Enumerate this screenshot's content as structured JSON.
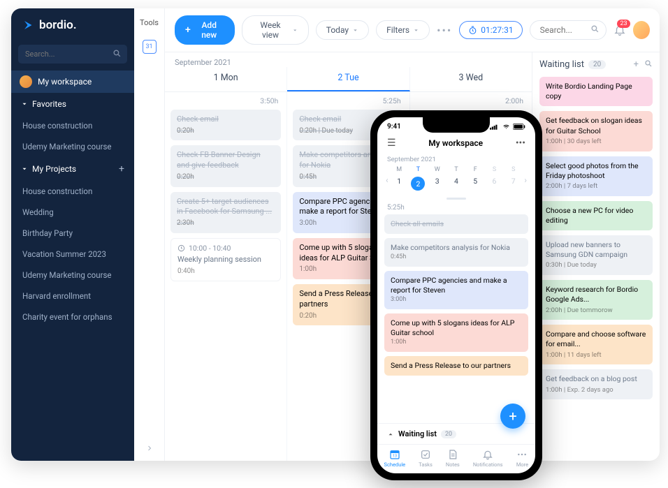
{
  "brand": {
    "name": "bordio."
  },
  "sidebar": {
    "search_placeholder": "Search...",
    "workspace": "My workspace",
    "favorites_label": "Favorites",
    "favorites": [
      "House construction",
      "Udemy Marketing course"
    ],
    "projects_label": "My Projects",
    "projects": [
      "House construction",
      "Wedding",
      "Birthday Party",
      "Vacation Summer 2023",
      "Udemy Marketing course",
      "Harvard enrollment",
      "Charity event for orphans"
    ]
  },
  "tools_label": "Tools",
  "calendar_day": "31",
  "toolbar": {
    "add": "Add new",
    "view": "Week view",
    "today": "Today",
    "filters": "Filters",
    "timer": "01:27:31",
    "search_placeholder": "Search...",
    "badge": "23"
  },
  "schedule": {
    "month": "September 2021",
    "days": [
      {
        "label": "1 Mon",
        "hours": "3:50h"
      },
      {
        "label": "2 Tue",
        "hours": "5:25h"
      },
      {
        "label": "3 Wed",
        "hours": "2:00h"
      }
    ],
    "col1": [
      {
        "title": "Check email",
        "meta": "0:20h",
        "cls": "gray done"
      },
      {
        "title": "Check FB Banner Design and give feedback",
        "meta": "0:20h",
        "cls": "gray done"
      },
      {
        "title": "Create 5+ target audiences in Facebook for Samsung ...",
        "meta": "2:30h",
        "cls": "gray done"
      }
    ],
    "timed": {
      "time": "10:00 - 10:40",
      "title": "Weekly planning session",
      "meta": "0:40h"
    },
    "col2": [
      {
        "title": "Check email",
        "meta": "0:20h | Due today",
        "cls": "gray done"
      },
      {
        "title": "Make competitors analysis for Nokia",
        "meta": "0:45h",
        "cls": "gray done"
      },
      {
        "title": "Compare PPC agencies and make a report for Steven",
        "meta": "3:00h",
        "cls": "blue"
      },
      {
        "title": "Come up with 5 slogan ideas for ALP Guitar School",
        "meta": "1:00h",
        "cls": "red"
      },
      {
        "title": "Send a Press Release to our partners",
        "meta": "0:20h",
        "cls": "orange"
      }
    ]
  },
  "waiting": {
    "title": "Waiting list",
    "count": "20",
    "items": [
      {
        "title": "Write Bordio Landing Page copy",
        "meta": "",
        "cls": "pink"
      },
      {
        "title": "Get feedback on slogan ideas for Guitar School",
        "meta": "1:00h | 30 days left",
        "cls": "red"
      },
      {
        "title": "Select good photos from the Friday photoshoot",
        "meta": "2:00h | 7 days left",
        "cls": "blue"
      },
      {
        "title": "Choose a new PC for video editing",
        "meta": "",
        "cls": "green"
      },
      {
        "title": "Upload new banners to Samsung GDN campaign",
        "meta": "0:30h | Due today",
        "cls": "gray"
      },
      {
        "title": "Keyword research for Bordio Google Ads...",
        "meta": "2:00h | Due tommorow",
        "cls": "green"
      },
      {
        "title": "Compare and choose software for email...",
        "meta": "1:00h | 11 days left",
        "cls": "orange"
      },
      {
        "title": "Get feedback on a blog post",
        "meta": "1:00h | Exp. 2 days ago",
        "cls": "gray"
      }
    ]
  },
  "phone": {
    "time": "9:41",
    "title": "My workspace",
    "month": "September 2021",
    "dow": [
      "M",
      "T",
      "W",
      "T",
      "F",
      "S",
      "S"
    ],
    "dates": [
      "1",
      "2",
      "3",
      "4",
      "5",
      "6",
      "7"
    ],
    "active_index": 1,
    "hours": "5:25h",
    "tasks": [
      {
        "title": "Check all emails",
        "meta": "",
        "cls": "gray done"
      },
      {
        "title": "Make competitors analysis for Nokia",
        "meta": "0:45h",
        "cls": "gray"
      },
      {
        "title": "Compare PPC agencies and make a report for Steven",
        "meta": "3:00h",
        "cls": "blue"
      },
      {
        "title": "Come up with 5 slogans ideas for ALP Guitar school",
        "meta": "1:00h",
        "cls": "red"
      },
      {
        "title": "Send a Press Release to our partners",
        "meta": "",
        "cls": "orange"
      }
    ],
    "waiting_label": "Waiting list",
    "waiting_count": "20",
    "tabs": [
      "Schedule",
      "Tasks",
      "Notes",
      "Notifications",
      "More"
    ]
  }
}
